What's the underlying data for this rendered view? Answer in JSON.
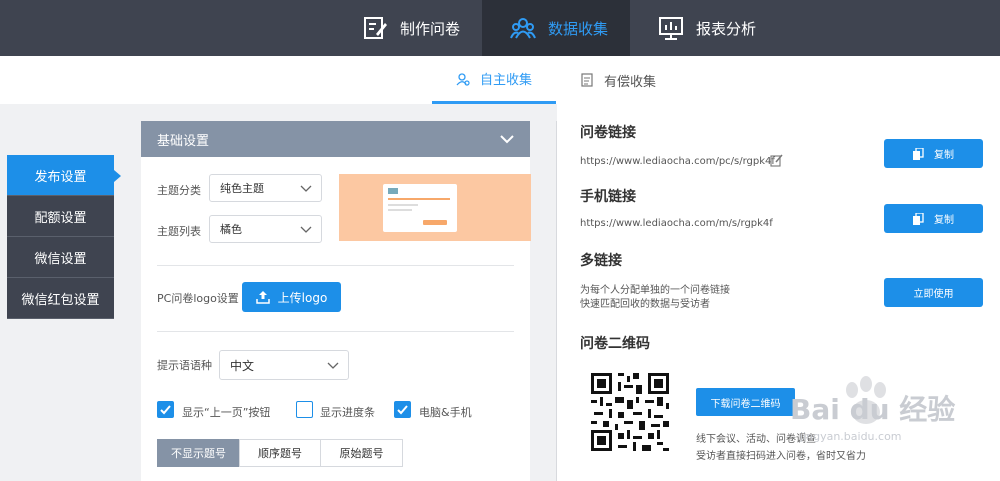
{
  "topnav": {
    "items": [
      {
        "label": "制作问卷",
        "icon": "edit-form-icon"
      },
      {
        "label": "数据收集",
        "icon": "users-icon",
        "active": true
      },
      {
        "label": "报表分析",
        "icon": "chart-board-icon"
      }
    ]
  },
  "subtabs": [
    {
      "label": "自主收集",
      "icon": "user-search-icon",
      "active": true
    },
    {
      "label": "有偿收集",
      "icon": "document-icon"
    }
  ],
  "leftmenu": {
    "items": [
      {
        "label": "发布设置",
        "active": true
      },
      {
        "label": "配额设置"
      },
      {
        "label": "微信设置"
      },
      {
        "label": "微信红包设置"
      }
    ]
  },
  "basic": {
    "title": "基础设置",
    "theme_category_label": "主题分类",
    "theme_category_value": "纯色主题",
    "theme_list_label": "主题列表",
    "theme_list_value": "橘色",
    "logo_label": "PC问卷logo设置",
    "upload_label": "上传logo",
    "language_label": "提示语语种",
    "language_value": "中文",
    "checkboxes": [
      {
        "label": "显示“上一页”按钮",
        "checked": true
      },
      {
        "label": "显示进度条",
        "checked": false
      },
      {
        "label": "电脑&手机",
        "checked": true
      }
    ],
    "numbering": [
      {
        "label": "不显示题号",
        "active": true
      },
      {
        "label": "顺序题号"
      },
      {
        "label": "原始题号"
      }
    ]
  },
  "links": {
    "survey_title": "问卷链接",
    "survey_url": "https://www.lediaocha.com/pc/s/rgpk4f",
    "mobile_title": "手机链接",
    "mobile_url": "https://www.lediaocha.com/m/s/rgpk4f",
    "copy_label": "复制",
    "multi_title": "多链接",
    "multi_desc_1": "为每个人分配单独的一个问卷链接",
    "multi_desc_2": "快速匹配回收的数据与受访者",
    "use_now_label": "立即使用",
    "qr_title": "问卷二维码",
    "download_qr_label": "下载问卷二维码",
    "qr_desc_1": "线下会议、活动、问卷调查",
    "qr_desc_2": "受访者直接扫码进入问卷，省时又省力"
  },
  "watermark": {
    "text": "Bai du 经验",
    "sub": "jingyan.baidu.com"
  },
  "colors": {
    "accent": "#1d8fe8",
    "topbar": "#3f4450",
    "panel_head": "#8593a6",
    "preview": "#fcc8a2"
  }
}
